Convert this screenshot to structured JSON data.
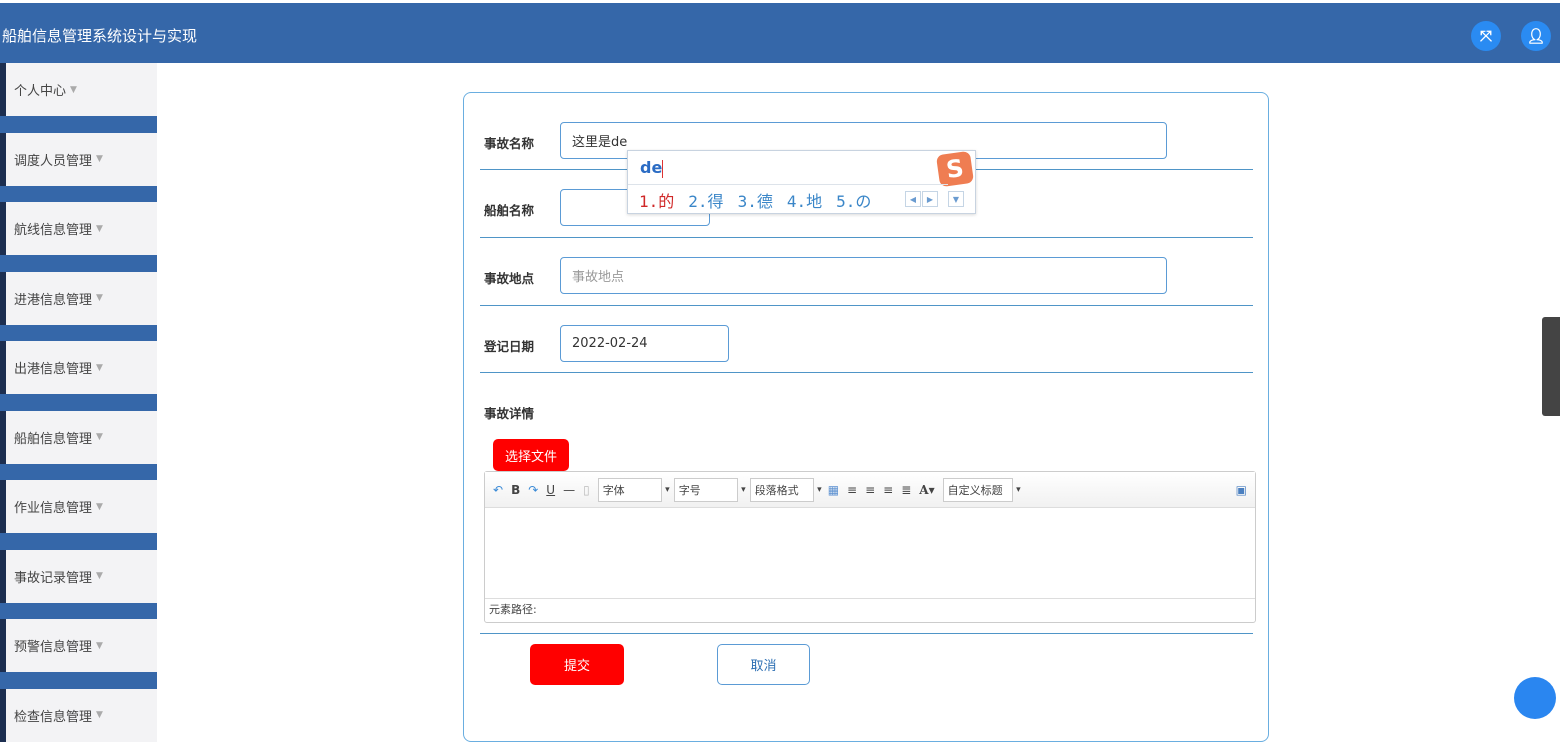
{
  "header": {
    "title": "船舶信息管理系统设计与实现",
    "icons": [
      "fullscreen-icon",
      "user-icon"
    ]
  },
  "sidebar": {
    "items": [
      "个人中心",
      "调度人员管理",
      "航线信息管理",
      "进港信息管理",
      "出港信息管理",
      "船舶信息管理",
      "作业信息管理",
      "事故记录管理",
      "预警信息管理",
      "检查信息管理"
    ]
  },
  "form": {
    "accident_name": {
      "label": "事故名称",
      "value": "这里是de"
    },
    "ship_name": {
      "label": "船舶名称",
      "value": ""
    },
    "location": {
      "label": "事故地点",
      "placeholder": "事故地点"
    },
    "date": {
      "label": "登记日期",
      "value": "2022-02-24"
    },
    "details": {
      "label": "事故详情"
    },
    "choose_file": "选择文件",
    "submit": "提交",
    "cancel": "取消"
  },
  "editor": {
    "font": "字体",
    "size": "字号",
    "paragraph": "段落格式",
    "custom": "自定义标题",
    "path_label": "元素路径:"
  },
  "ime": {
    "pinyin": "de",
    "candidates": [
      "1.的",
      "2.得",
      "3.德",
      "4.地",
      "5.の"
    ]
  },
  "colors": {
    "header": "#3567a9",
    "submit": "#ff0000",
    "accent": "#2a8bf2"
  }
}
